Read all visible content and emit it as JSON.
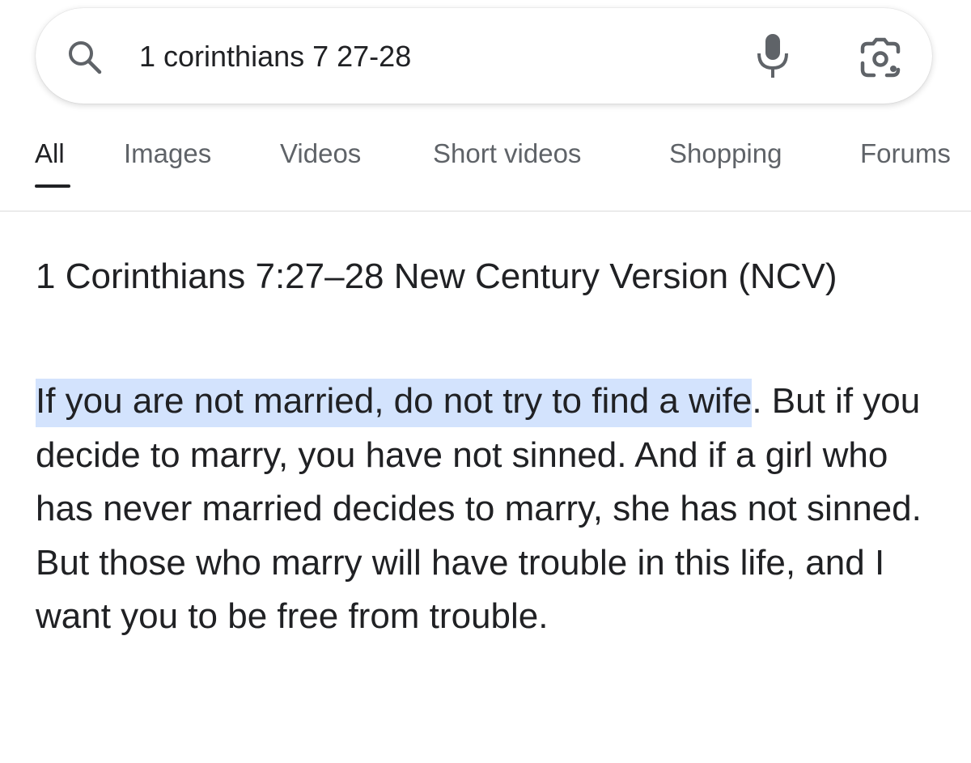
{
  "search": {
    "query": "1 corinthians 7 27-28",
    "icons": {
      "search": "search-icon",
      "voice": "microphone-icon",
      "lens": "google-lens-icon"
    }
  },
  "tabs": [
    {
      "label": "All",
      "active": true
    },
    {
      "label": "Images",
      "active": false
    },
    {
      "label": "Videos",
      "active": false
    },
    {
      "label": "Short videos",
      "active": false
    },
    {
      "label": "Shopping",
      "active": false
    },
    {
      "label": "Forums",
      "active": false
    }
  ],
  "result": {
    "title": "1 Corinthians 7:27–28 New Century Version (NCV)",
    "highlighted_text": "If you are not married, do not try to find a wife",
    "body_text": ". But if you decide to marry, you have not sinned. And if a girl who has never married decides to marry, she has not sinned. But those who marry will have trouble in this life, and I want you to be free from trouble."
  },
  "colors": {
    "text": "#202124",
    "tab_inactive": "#5f6368",
    "highlight": "#d3e3fd",
    "icon": "#5f6368"
  }
}
